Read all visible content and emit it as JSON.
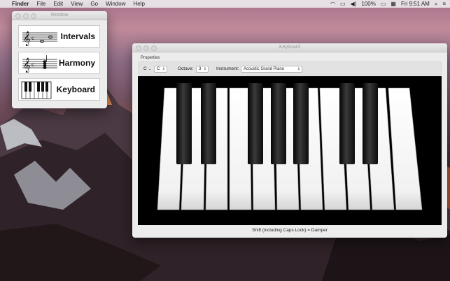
{
  "menubar": {
    "items": [
      "Finder",
      "File",
      "Edit",
      "View",
      "Go",
      "Window",
      "Help"
    ],
    "battery": "100%",
    "clock": "Fri 9:51 AM"
  },
  "launcher": {
    "title": "Window",
    "tiles": [
      "Intervals",
      "Harmony",
      "Keyboard"
    ]
  },
  "keyboard_window": {
    "title": "Keyboard",
    "properties_label": "Properties",
    "key_value": "C",
    "key2_value": "C",
    "octave_label": "Octave:",
    "octave_value": "3",
    "instrument_label": "Instrument:",
    "instrument_value": "Acoustic Grand Piano",
    "footer": "Shift (including Caps Lock) = Damper"
  }
}
